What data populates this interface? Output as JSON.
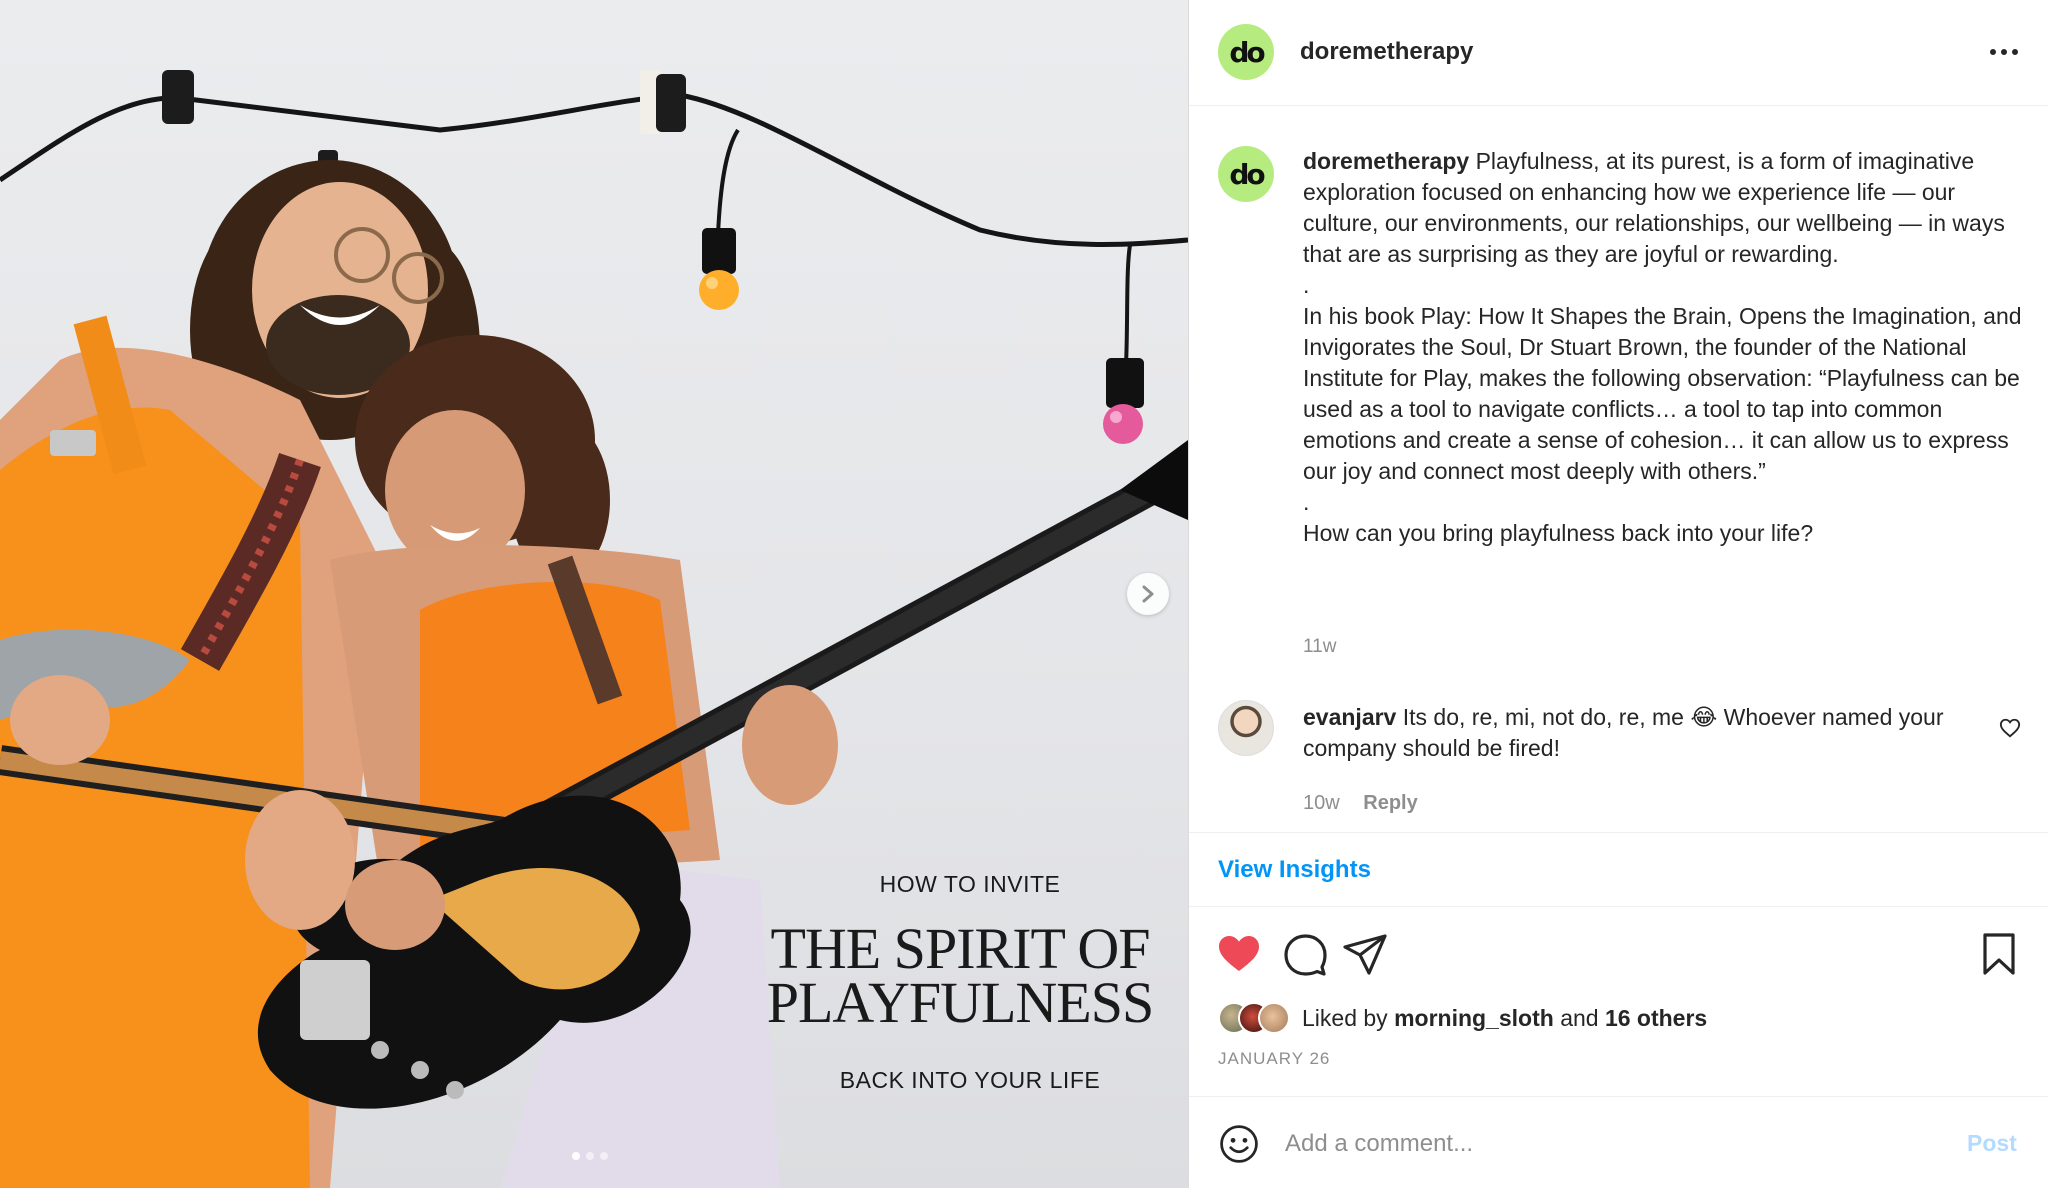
{
  "post_image": {
    "overlay_top": "HOW TO INVITE",
    "overlay_title_line1": "THE SPIRIT OF",
    "overlay_title_line2": "PLAYFULNESS",
    "overlay_bottom": "BACK INTO YOUR LIFE",
    "carousel_total": 3,
    "carousel_active": 1
  },
  "header": {
    "avatar_text": "do",
    "username": "doremetherapy"
  },
  "caption": {
    "username": "doremetherapy",
    "para1": "Playfulness, at its purest, is a form of imaginative exploration focused on enhancing how we experience life — our culture, our environments, our relationships, our wellbeing — in ways that are as surprising as they are joyful or rewarding.",
    "sep1": ".",
    "para2": "In his book Play: How It Shapes the Brain, Opens the Imagination, and Invigorates the Soul, Dr Stuart Brown, the founder of the National Institute for Play, makes the following observation: “Playfulness can be used as a tool to navigate conflicts… a tool to tap into common emotions and create a sense of cohesion… it can allow us to express our joy and connect most deeply with others.”",
    "sep2": ".",
    "para3": "How can you bring playfulness back into your life?",
    "time": "11w"
  },
  "comment": {
    "username": "evanjarv",
    "text": "Its do, re, mi, not do, re, me 😂 Whoever named your company should be fired!",
    "time": "10w",
    "reply_label": "Reply"
  },
  "insights_label": "View Insights",
  "likes": {
    "prefix": "Liked by",
    "user": "morning_sloth",
    "conj": "and",
    "others": "16 others"
  },
  "date": "JANUARY 26",
  "add_comment": {
    "placeholder": "Add a comment...",
    "post_label": "Post"
  },
  "colors": {
    "accent_blue": "#0095f6",
    "like_red": "#ed4956",
    "avatar_green": "#b6ec7f",
    "overall_orange": "#f79a1e"
  },
  "icons": [
    "more-options-icon",
    "heart-filled-icon",
    "comment-icon",
    "share-icon",
    "bookmark-icon",
    "emoji-icon",
    "chevron-right-icon",
    "heart-outline-icon"
  ]
}
